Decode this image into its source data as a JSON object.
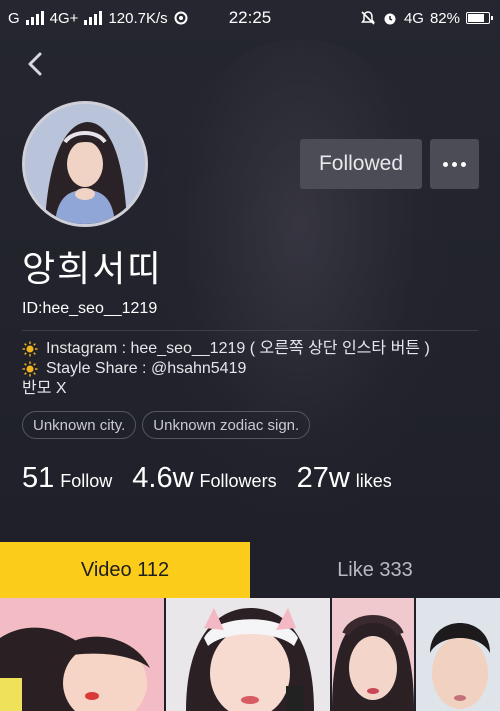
{
  "status_bar": {
    "carrier1": "G",
    "carrier2": "4G+",
    "speed": "120.7K/s",
    "time": "22:25",
    "network": "4G",
    "battery_text": "82%",
    "battery_level": 0.82
  },
  "profile": {
    "username": "앙희서띠",
    "id_text": "ID:hee_seo__1219",
    "follow_button": "Followed",
    "bio": [
      "Instagram : hee_seo__1219 ( 오른쪽 상단 인스타 버튼 )",
      "Stayle Share : @hsahn5419",
      "반모 X"
    ],
    "tags": [
      "Unknown city.",
      "Unknown zodiac sign."
    ],
    "stats": {
      "follow_count": "51",
      "follow_label": "Follow",
      "followers_count": "4.6w",
      "followers_label": "Followers",
      "likes_count": "27w",
      "likes_label": "likes"
    }
  },
  "tabs": [
    {
      "label": "Video 112",
      "active": true
    },
    {
      "label": "Like 333",
      "active": false
    }
  ],
  "icons": {
    "back": "back-icon",
    "more": "more-icon",
    "bio_bullet": "sun-icon"
  },
  "colors": {
    "accent": "#fbcc19",
    "background": "#1f2029",
    "button": "#4b4c55"
  }
}
